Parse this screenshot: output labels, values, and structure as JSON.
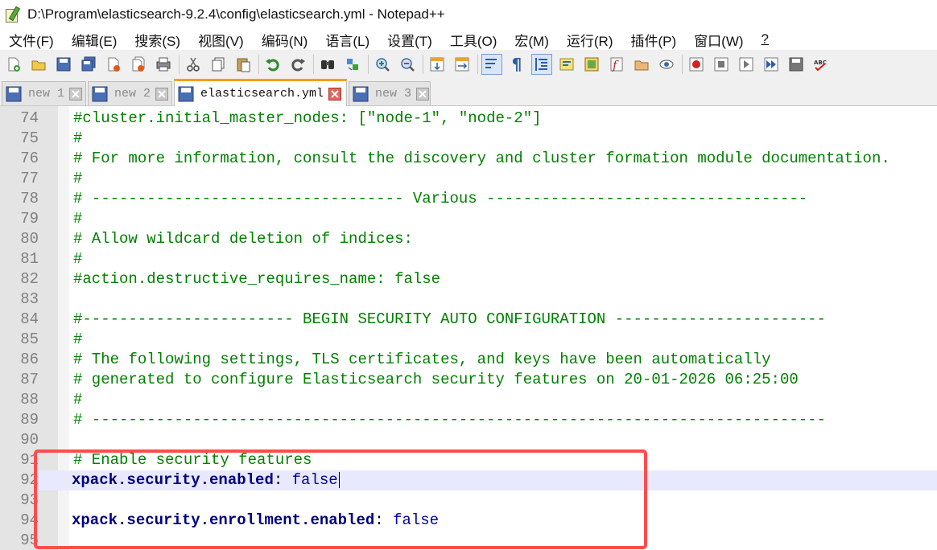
{
  "window": {
    "title": "D:\\Program\\elasticsearch-9.2.4\\config\\elasticsearch.yml - Notepad++"
  },
  "menu": [
    {
      "label": "文件(F)"
    },
    {
      "label": "编辑(E)"
    },
    {
      "label": "搜索(S)"
    },
    {
      "label": "视图(V)"
    },
    {
      "label": "编码(N)"
    },
    {
      "label": "语言(L)"
    },
    {
      "label": "设置(T)"
    },
    {
      "label": "工具(O)"
    },
    {
      "label": "宏(M)"
    },
    {
      "label": "运行(R)"
    },
    {
      "label": "插件(P)"
    },
    {
      "label": "窗口(W)"
    },
    {
      "label": "?"
    }
  ],
  "toolbar_icons": [
    "new-file-icon",
    "open-file-icon",
    "save-icon",
    "save-all-icon",
    "close-icon",
    "close-all-icon",
    "print-icon",
    "cut-icon",
    "copy-icon",
    "paste-icon",
    "undo-icon",
    "redo-icon",
    "find-icon",
    "replace-icon",
    "zoom-in-icon",
    "zoom-out-icon",
    "sync-vertical-icon",
    "sync-horizontal-icon",
    "word-wrap-icon",
    "show-all-chars-icon",
    "indent-guide-icon",
    "udl-icon",
    "doc-map-icon",
    "function-list-icon",
    "folder-workspace-icon",
    "monitoring-icon",
    "record-macro-icon",
    "stop-macro-icon",
    "play-macro-icon",
    "run-macro-multiple-icon",
    "save-macro-icon",
    "spell-check-icon"
  ],
  "tabs": [
    {
      "label": "new 1",
      "active": false
    },
    {
      "label": "new 2",
      "active": false
    },
    {
      "label": "elasticsearch.yml",
      "active": true
    },
    {
      "label": "new 3",
      "active": false
    }
  ],
  "editor": {
    "lines": [
      {
        "num": "74",
        "text": "#cluster.initial_master_nodes: [\"node-1\", \"node-2\"]"
      },
      {
        "num": "75",
        "text": "#"
      },
      {
        "num": "76",
        "text": "# For more information, consult the discovery and cluster formation module documentation."
      },
      {
        "num": "77",
        "text": "#"
      },
      {
        "num": "78",
        "text": "# ---------------------------------- Various -----------------------------------"
      },
      {
        "num": "79",
        "text": "#"
      },
      {
        "num": "80",
        "text": "# Allow wildcard deletion of indices:"
      },
      {
        "num": "81",
        "text": "#"
      },
      {
        "num": "82",
        "text": "#action.destructive_requires_name: false"
      },
      {
        "num": "83",
        "text": ""
      },
      {
        "num": "84",
        "text": "#----------------------- BEGIN SECURITY AUTO CONFIGURATION -----------------------"
      },
      {
        "num": "85",
        "text": "#"
      },
      {
        "num": "86",
        "text": "# The following settings, TLS certificates, and keys have been automatically"
      },
      {
        "num": "87",
        "text": "# generated to configure Elasticsearch security features on 20-01-2026 06:25:00"
      },
      {
        "num": "88",
        "text": "#"
      },
      {
        "num": "89",
        "text": "# --------------------------------------------------------------------------------"
      },
      {
        "num": "90",
        "text": ""
      },
      {
        "num": "91",
        "text": "# Enable security features"
      },
      {
        "num": "92",
        "key": "xpack.security.enabled",
        "colon": ":",
        "value": " false",
        "current": true
      },
      {
        "num": "93",
        "text": ""
      },
      {
        "num": "94",
        "key": "xpack.security.enrollment.enabled",
        "colon": ":",
        "value": " false"
      },
      {
        "num": "95",
        "text": ""
      }
    ]
  },
  "colors": {
    "comment": "#008000",
    "key": "#000080",
    "value": "#0000a0",
    "highlight_box": "#ff4d4d",
    "current_line": "#e8e8ff",
    "active_tab_accent": "#f5a100"
  }
}
